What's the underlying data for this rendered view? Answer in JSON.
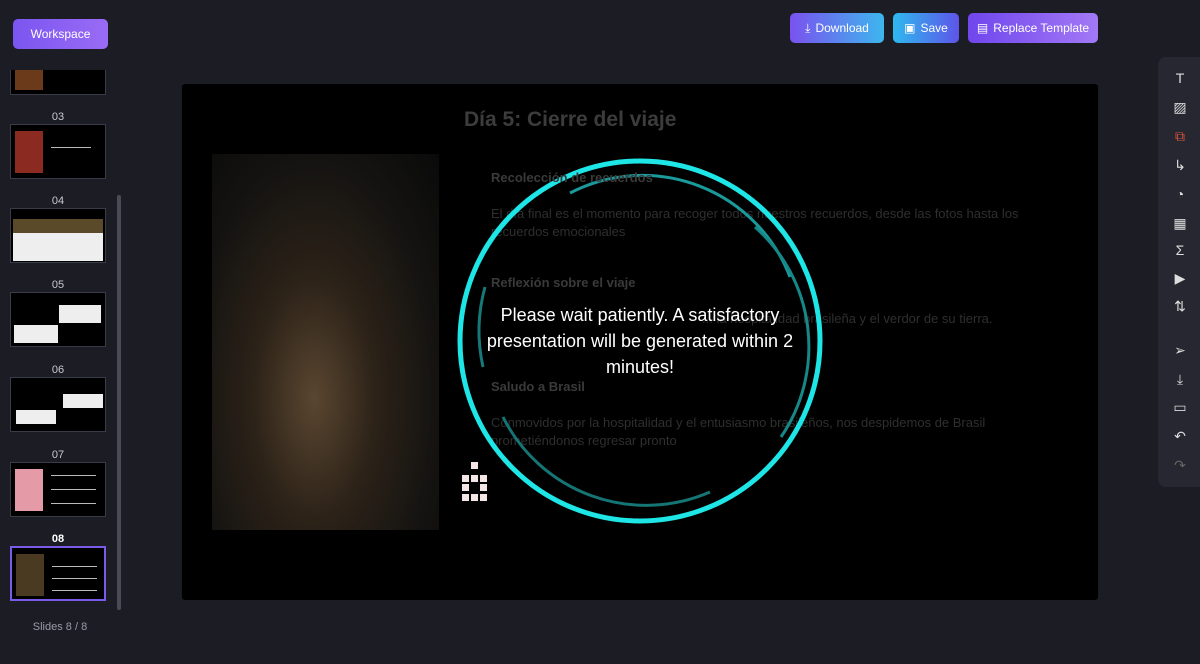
{
  "header": {
    "workspace_label": "Workspace",
    "download_label": "Download",
    "save_label": "Save",
    "replace_template_label": "Replace Template"
  },
  "sidebar": {
    "thumbnails": [
      {
        "number": "03"
      },
      {
        "number": "04"
      },
      {
        "number": "05"
      },
      {
        "number": "06"
      },
      {
        "number": "07"
      },
      {
        "number": "08",
        "active": true
      }
    ],
    "slides_count": "Slides 8 / 8"
  },
  "slide": {
    "title": "Día 5: Cierre del viaje",
    "sections": [
      {
        "heading": "Recolección de recuerdos",
        "text": "El día final es el momento para recoger todos nuestros recuerdos, desde las fotos hasta los recuerdos emocionales"
      },
      {
        "heading": "Reflexión sobre el viaje",
        "text": "... la hospitalidad brasileña y el verdor de su tierra."
      },
      {
        "heading": "Saludo a Brasil",
        "text": "Conmovidos por la hospitalidad y el entusiasmo brasileños, nos despidemos de Brasil prometiéndonos regresar pronto"
      }
    ]
  },
  "overlay": {
    "message": "Please wait patiently. A satisfactory presentation will be generated within 2 minutes!",
    "ring_color": "#1ee6e6"
  },
  "toolbar": [
    "text-icon",
    "image-icon",
    "shape-icon",
    "connector-icon",
    "chart-icon",
    "table-icon",
    "formula-icon",
    "video-icon",
    "transition-icon",
    "pointer-icon",
    "download-icon",
    "present-icon",
    "undo-icon",
    "redo-icon"
  ]
}
